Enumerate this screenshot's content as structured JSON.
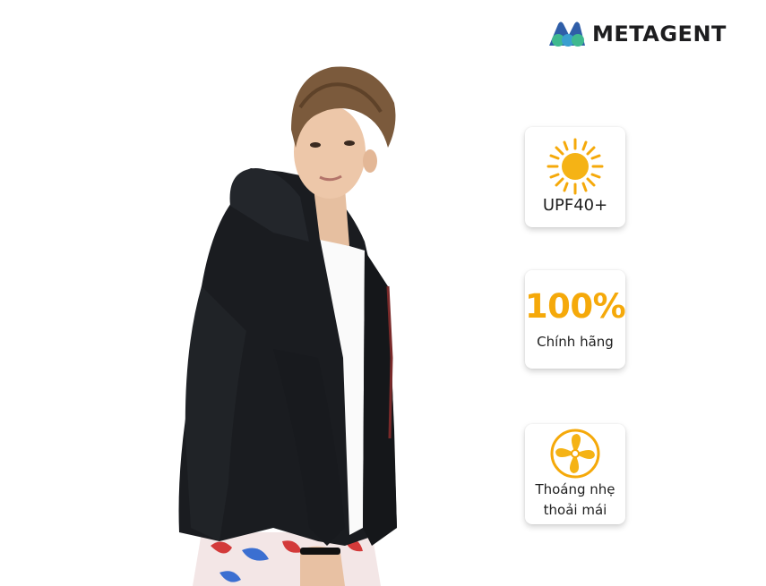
{
  "brand": {
    "name": "METAGENT"
  },
  "badges": [
    {
      "icon": "sun-icon",
      "label": "UPF40+"
    },
    {
      "headline": "100%",
      "label": "Chính hãng"
    },
    {
      "icon": "fan-icon",
      "label_line1": "Thoáng nhẹ",
      "label_line2": "thoải mái"
    }
  ],
  "colors": {
    "accent": "#f5a90a",
    "logo_blue": "#2f5ea8",
    "logo_teal": "#3fb98f"
  },
  "product_image": {
    "subject": "black hooded windbreaker jacket"
  }
}
